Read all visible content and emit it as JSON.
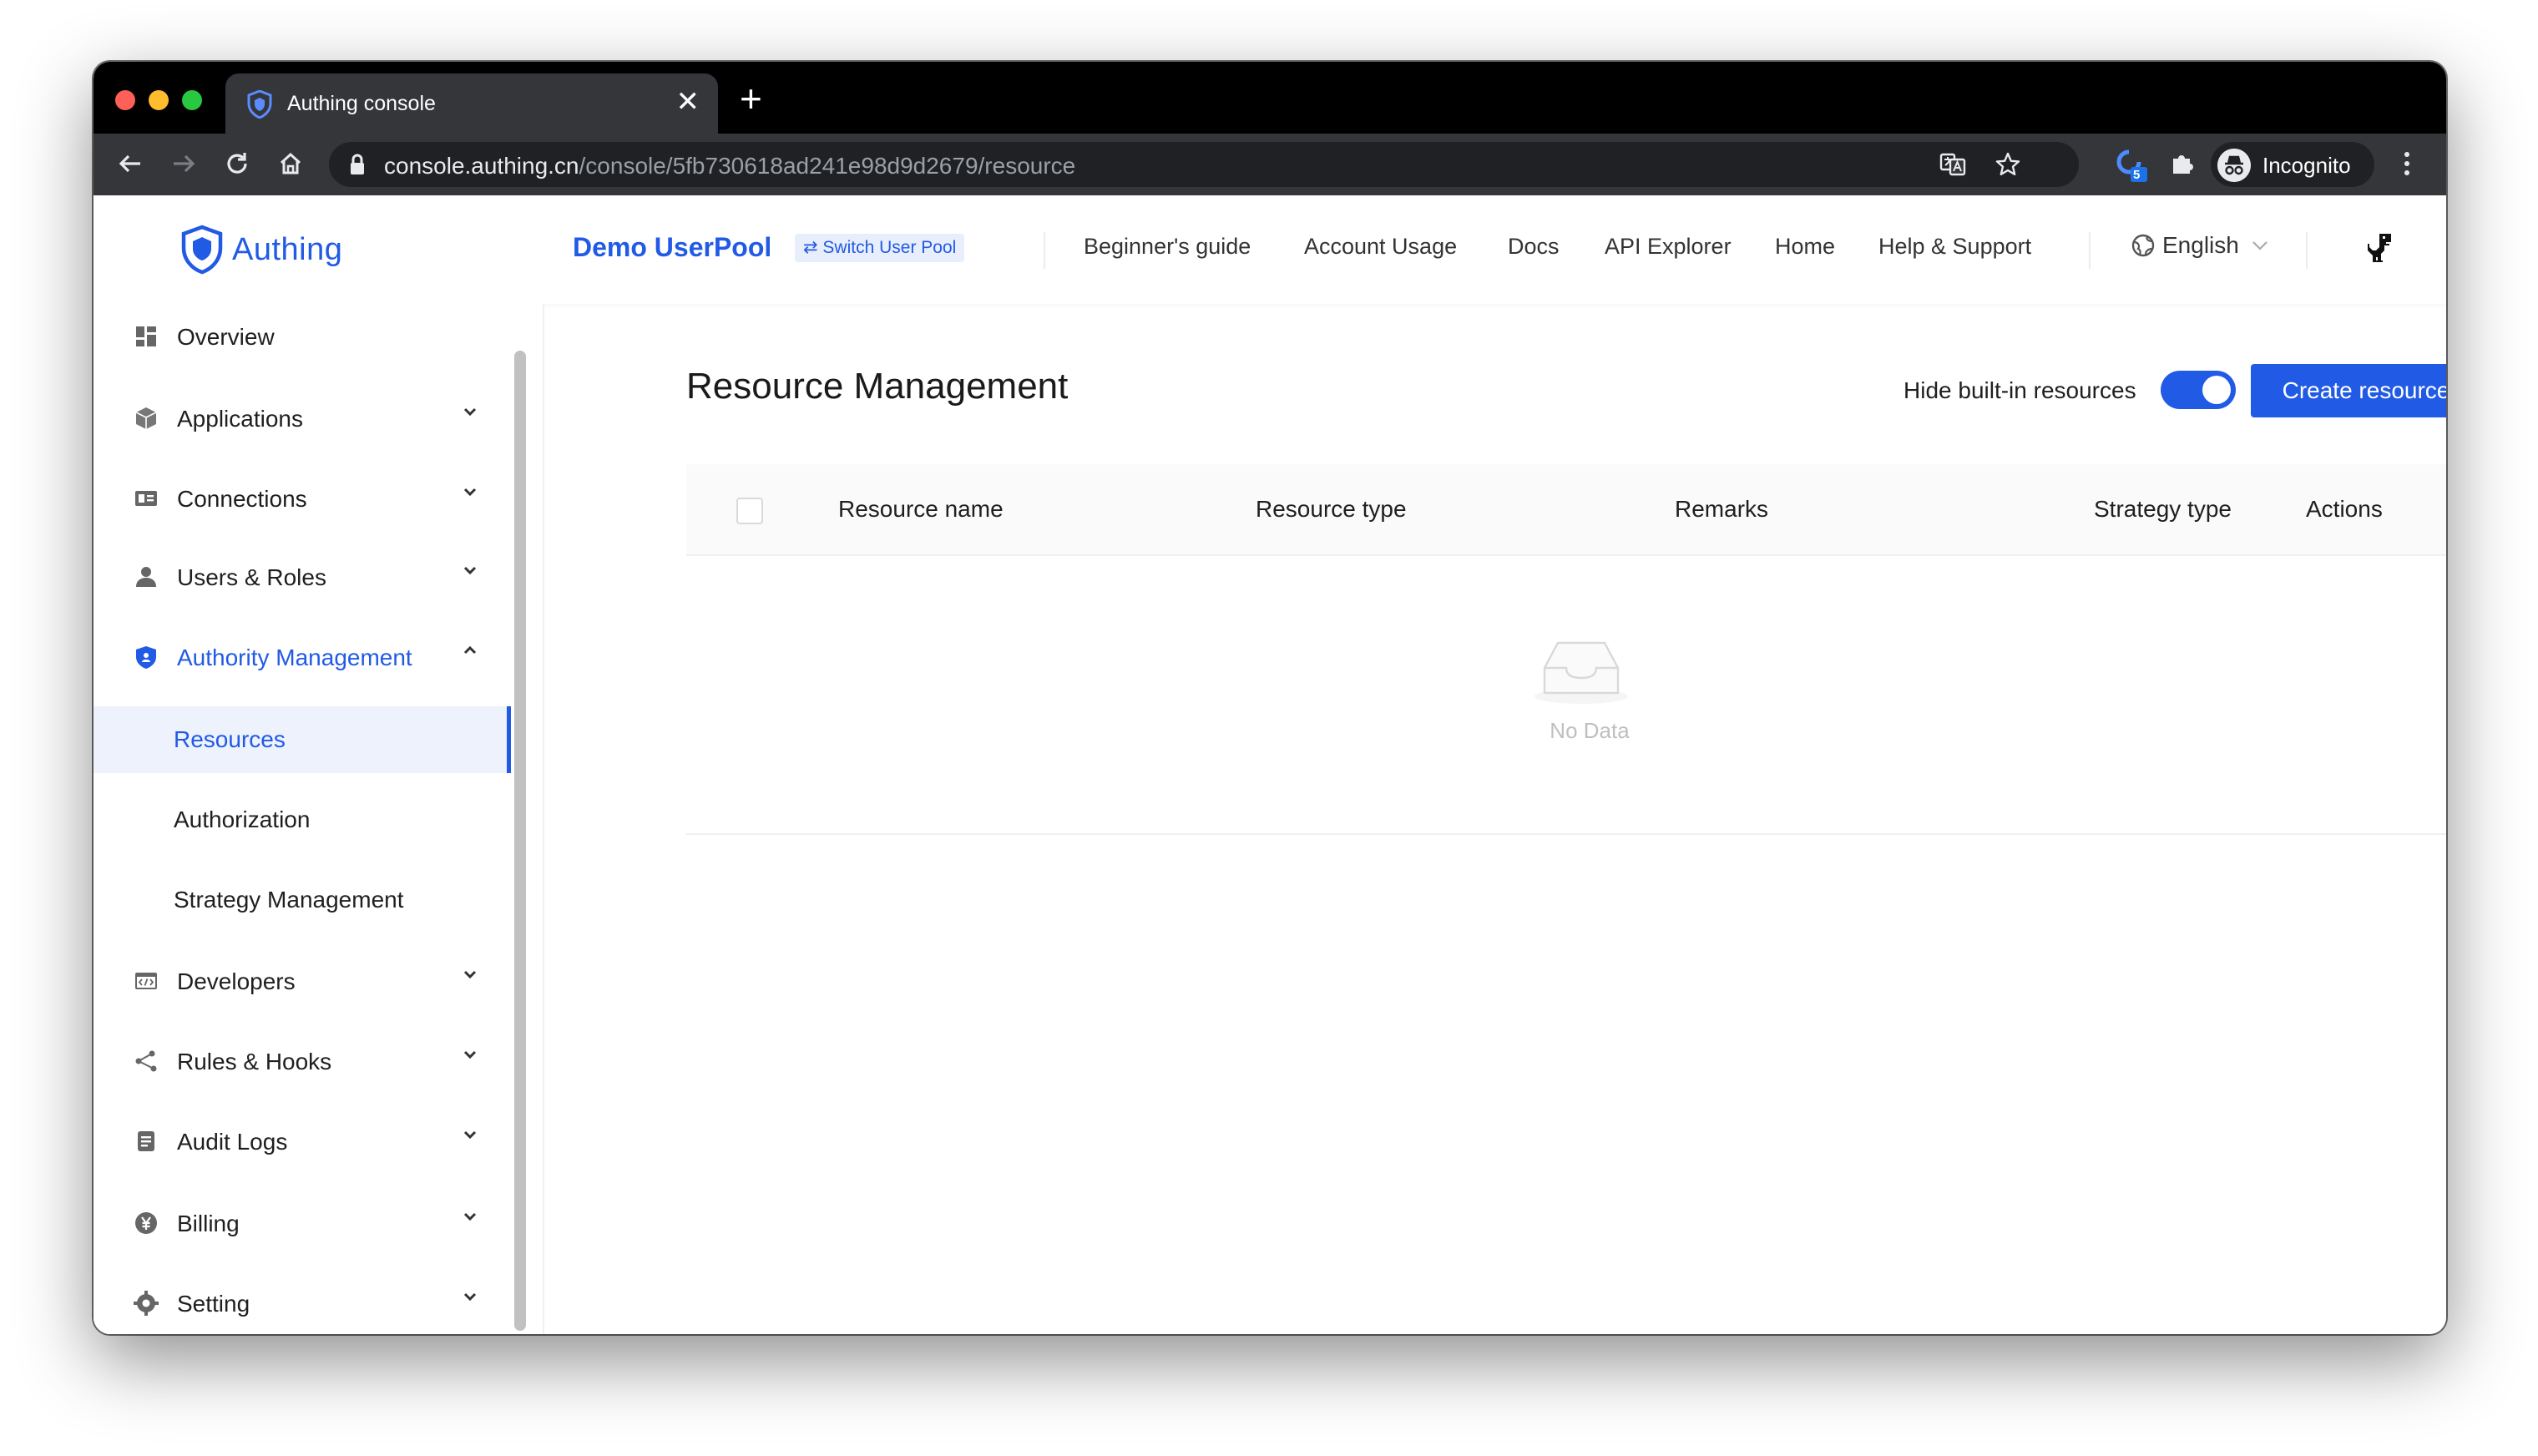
{
  "browser": {
    "tab_title": "Authing console",
    "tab_close_glyph": "✕",
    "new_tab_glyph": "+",
    "url_host": "console.authing.cn",
    "url_path": "/console/5fb730618ad241e98d9d2679/resource",
    "extension_badge": "5",
    "incognito_label": "Incognito"
  },
  "header": {
    "logo_text": "Authing",
    "pool_name": "Demo UserPool",
    "switch_pool_label": "⇄ Switch User Pool",
    "nav": [
      "Beginner's guide",
      "Account Usage",
      "Docs",
      "API Explorer",
      "Home",
      "Help & Support"
    ],
    "language": "English"
  },
  "sidebar": {
    "items": [
      {
        "label": "Overview",
        "icon": "dashboard-icon"
      },
      {
        "label": "Applications",
        "icon": "cube-icon"
      },
      {
        "label": "Connections",
        "icon": "id-card-icon"
      },
      {
        "label": "Users & Roles",
        "icon": "user-icon"
      },
      {
        "label": "Authority Management",
        "icon": "shield-icon"
      },
      {
        "label": "Developers",
        "icon": "code-icon"
      },
      {
        "label": "Rules & Hooks",
        "icon": "share-icon"
      },
      {
        "label": "Audit Logs",
        "icon": "document-icon"
      },
      {
        "label": "Billing",
        "icon": "yen-icon"
      },
      {
        "label": "Setting",
        "icon": "gear-icon"
      }
    ],
    "sub_items": [
      "Resources",
      "Authorization",
      "Strategy Management"
    ]
  },
  "main": {
    "title": "Resource Management",
    "hide_builtin_label": "Hide built-in resources",
    "hide_builtin_on": true,
    "create_button": "Create resources",
    "columns": [
      "Resource name",
      "Resource type",
      "Remarks",
      "Strategy type",
      "Actions"
    ],
    "empty_text": "No Data"
  },
  "colors": {
    "accent": "#215ae5",
    "selected_bg": "#edf2fd"
  }
}
